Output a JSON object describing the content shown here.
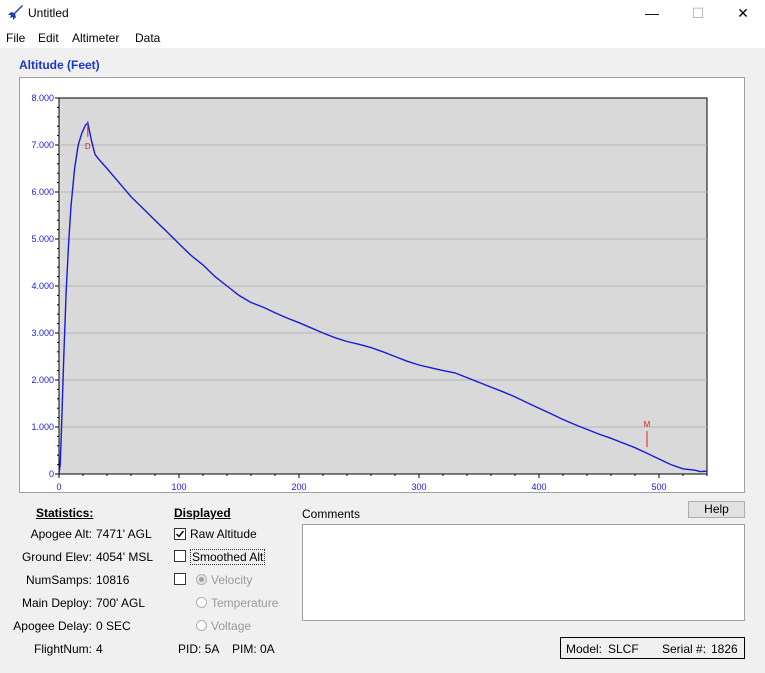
{
  "window": {
    "title": "Untitled",
    "minimize": "—",
    "maximize": "☐",
    "close": "✕"
  },
  "menu": [
    "File",
    "Edit",
    "Altimeter",
    "Data"
  ],
  "chart": {
    "heading": "Altitude (Feet)",
    "markers": {
      "deploy": "D",
      "main": "M"
    }
  },
  "chart_data": {
    "type": "line",
    "title": "Altitude (Feet)",
    "xlabel": "",
    "ylabel": "",
    "xlim": [
      0,
      540
    ],
    "ylim": [
      0,
      8000
    ],
    "x_ticks": [
      0,
      100,
      200,
      300,
      400,
      500
    ],
    "y_ticks": [
      0,
      1000,
      2000,
      3000,
      4000,
      5000,
      6000,
      7000,
      8000
    ],
    "y_tick_labels": [
      "0",
      "1.000",
      "2.000",
      "3.000",
      "4.000",
      "5.000",
      "6.000",
      "7.000",
      "8.000"
    ],
    "grid": true,
    "line_color": "#1a1ad6",
    "series": [
      {
        "x": [
          0,
          1,
          2,
          4,
          6,
          8,
          10,
          13,
          16,
          19,
          22,
          24,
          25,
          27,
          30,
          33,
          40,
          50,
          60,
          70,
          80,
          90,
          100,
          110,
          120,
          130,
          140,
          150,
          160,
          170,
          180,
          190,
          200,
          210,
          220,
          230,
          240,
          250,
          260,
          270,
          280,
          290,
          300,
          310,
          320,
          330,
          340,
          350,
          360,
          370,
          380,
          390,
          400,
          410,
          420,
          430,
          440,
          450,
          460,
          470,
          480,
          490,
          500,
          510,
          520,
          530,
          534,
          540
        ],
        "y": [
          0,
          200,
          900,
          2500,
          3900,
          4900,
          5700,
          6500,
          7000,
          7250,
          7420,
          7471,
          7350,
          7100,
          6800,
          6700,
          6500,
          6200,
          5900,
          5650,
          5400,
          5150,
          4900,
          4650,
          4450,
          4200,
          4000,
          3800,
          3650,
          3550,
          3430,
          3320,
          3220,
          3110,
          3000,
          2900,
          2820,
          2760,
          2690,
          2600,
          2500,
          2400,
          2320,
          2260,
          2200,
          2150,
          2050,
          1950,
          1850,
          1750,
          1640,
          1520,
          1400,
          1280,
          1160,
          1050,
          950,
          850,
          760,
          660,
          560,
          440,
          320,
          200,
          110,
          80,
          50,
          60
        ]
      }
    ],
    "markers": [
      {
        "label": "D",
        "x": 24,
        "y": 7300
      },
      {
        "label": "M",
        "x": 490,
        "y": 700
      }
    ]
  },
  "statistics": {
    "header": "Statistics:",
    "rows": [
      {
        "label": "Apogee Alt:",
        "value": "7471' AGL"
      },
      {
        "label": "Ground Elev:",
        "value": "4054' MSL"
      },
      {
        "label": "NumSamps:",
        "value": "10816"
      },
      {
        "label": "Main Deploy:",
        "value": "700' AGL"
      },
      {
        "label": "Apogee Delay:",
        "value": "0 SEC"
      },
      {
        "label": "FlightNum:",
        "value": "4"
      }
    ]
  },
  "displayed": {
    "header": "Displayed",
    "raw_altitude": "Raw Altitude",
    "smoothed_alt": "Smoothed Alt",
    "velocity": "Velocity",
    "temperature": "Temperature",
    "voltage": "Voltage"
  },
  "pid": "PID: 5A",
  "pim": "PIM: 0A",
  "comments": {
    "label": "Comments",
    "value": ""
  },
  "help_button": "Help",
  "model": {
    "model_label": "Model:",
    "model_value": "SLCF",
    "serial_label": "Serial #:",
    "serial_value": "1826"
  }
}
